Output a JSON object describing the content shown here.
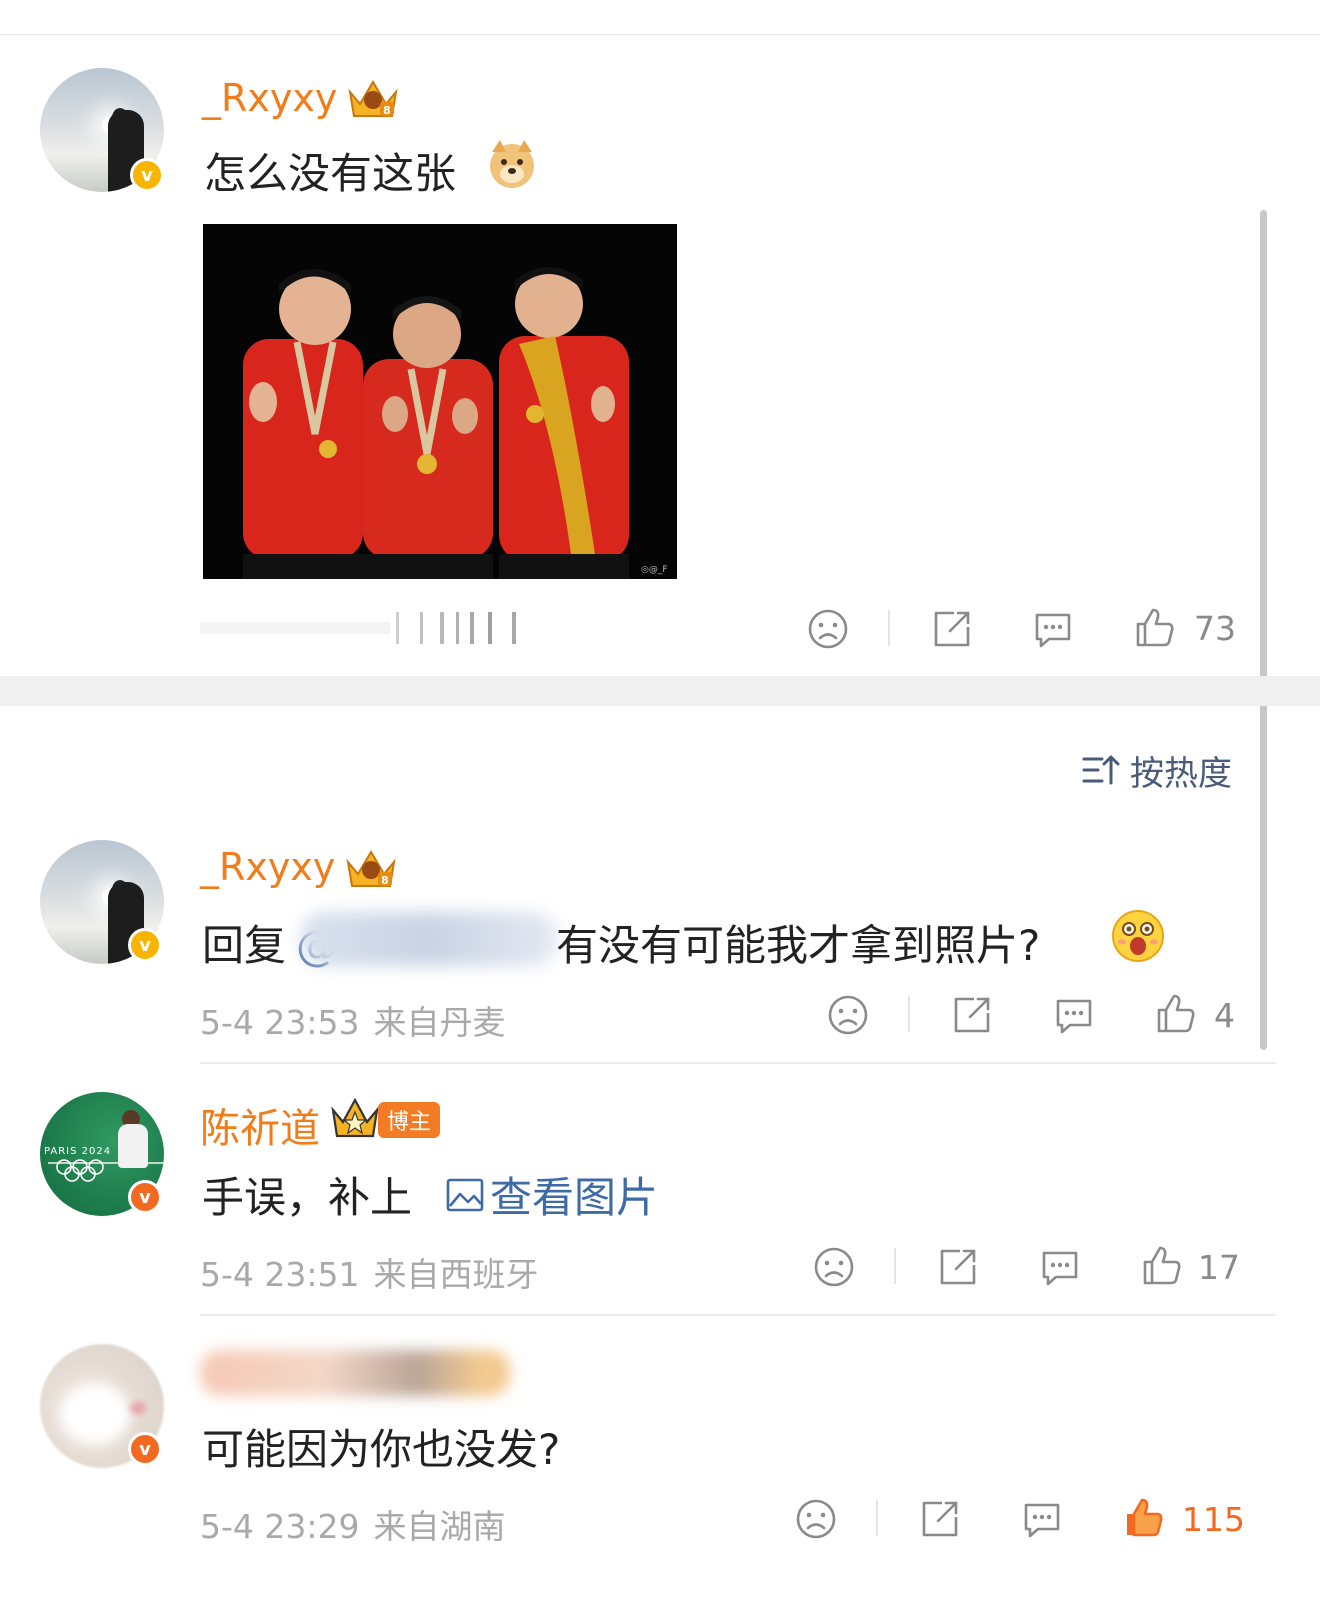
{
  "post": {
    "username": "_Rxyxy",
    "text": "怎么没有这张",
    "like_count": "73"
  },
  "sort": {
    "label": "按热度"
  },
  "comments": [
    {
      "username": "_Rxyxy",
      "reply_prefix": "回复",
      "mention_symbol": "@",
      "text": "有没有可能我才拿到照片?",
      "time": "5-4 23:53",
      "location": "来自丹麦",
      "like_count": "4"
    },
    {
      "username": "陈祈道",
      "badge": "博主",
      "text": "手误，补上",
      "link_text": "查看图片",
      "time": "5-4 23:51",
      "location": "来自西班牙",
      "like_count": "17"
    },
    {
      "username": "",
      "text": "可能因为你也没发?",
      "time": "5-4 23:29",
      "location": "来自湖南",
      "like_count": "115"
    }
  ],
  "colors": {
    "username": "#f07d1a",
    "meta_gray": "#a9a9a9",
    "like_active": "#f26a21",
    "link_blue": "#3e6aa8",
    "verified_gold": "#f7b500",
    "verified_orange": "#f26a21"
  },
  "icons": [
    "sad-face-icon",
    "share-icon",
    "comment-icon",
    "thumbs-up-icon",
    "sort-icon",
    "picture-icon",
    "crown-icon",
    "verified-badge-icon"
  ]
}
